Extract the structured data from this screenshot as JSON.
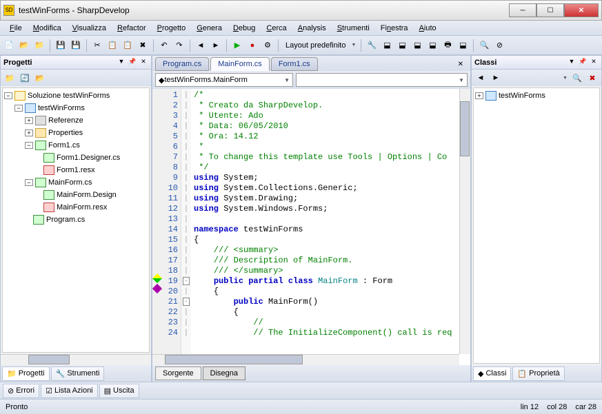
{
  "title": "testWinForms - SharpDevelop",
  "menu": [
    "File",
    "Modifica",
    "Visualizza",
    "Refactor",
    "Progetto",
    "Genera",
    "Debug",
    "Cerca",
    "Analysis",
    "Strumenti",
    "Finestra",
    "Aiuto"
  ],
  "toolbar_layout": "Layout predefinito",
  "panels": {
    "left": {
      "title": "Progetti"
    },
    "right": {
      "title": "Classi"
    }
  },
  "project_tree": {
    "solution": "Soluzione testWinForms",
    "project": "testWinForms",
    "referenze": "Referenze",
    "properties": "Properties",
    "form1": "Form1.cs",
    "form1_designer": "Form1.Designer.cs",
    "form1_resx": "Form1.resx",
    "mainform": "MainForm.cs",
    "mainform_designer": "MainForm.Design",
    "mainform_resx": "MainForm.resx",
    "program": "Program.cs"
  },
  "class_tree": {
    "root": "testWinForms"
  },
  "editor": {
    "tabs": [
      "Program.cs",
      "MainForm.cs",
      "Form1.cs"
    ],
    "active_tab": 1,
    "class_combo": "testWinForms.MainForm",
    "member_combo": "",
    "bottom_tabs": [
      "Sorgente",
      "Disegna"
    ]
  },
  "code": {
    "lines": [
      {
        "n": 1,
        "t": "/*",
        "cls": "c-comment"
      },
      {
        "n": 2,
        "t": " * Creato da SharpDevelop.",
        "cls": "c-comment"
      },
      {
        "n": 3,
        "t": " * Utente: Ado",
        "cls": "c-comment"
      },
      {
        "n": 4,
        "t": " * Data: 06/05/2010",
        "cls": "c-comment"
      },
      {
        "n": 5,
        "t": " * Ora: 14.12",
        "cls": "c-comment"
      },
      {
        "n": 6,
        "t": " * ",
        "cls": "c-comment"
      },
      {
        "n": 7,
        "t": " * To change this template use Tools | Options | Co",
        "cls": "c-comment"
      },
      {
        "n": 8,
        "t": " */",
        "cls": "c-comment"
      },
      {
        "n": 9,
        "html": "<span class='c-keyword'>using</span> System;"
      },
      {
        "n": 10,
        "html": "<span class='c-keyword'>using</span> System.Collections.Generic;"
      },
      {
        "n": 11,
        "html": "<span class='c-keyword'>using</span> System.Drawing;"
      },
      {
        "n": 12,
        "html": "<span class='c-keyword'>using</span> System.Windows.Forms;"
      },
      {
        "n": 13,
        "t": ""
      },
      {
        "n": 14,
        "html": "<span class='c-keyword'>namespace</span> testWinForms"
      },
      {
        "n": 15,
        "t": "{"
      },
      {
        "n": 16,
        "html": "    <span class='c-comment'>/// &lt;summary&gt;</span>"
      },
      {
        "n": 17,
        "html": "    <span class='c-comment'>/// Description of MainForm.</span>"
      },
      {
        "n": 18,
        "html": "    <span class='c-comment'>/// &lt;/summary&gt;</span>"
      },
      {
        "n": 19,
        "html": "    <span class='c-keyword'>public</span> <span class='c-keyword'>partial</span> <span class='c-keyword'>class</span> <span class='c-type'>MainForm</span> : Form",
        "fold": "-",
        "mark": "yg"
      },
      {
        "n": 20,
        "t": "    {",
        "mark": "pu"
      },
      {
        "n": 21,
        "html": "        <span class='c-keyword'>public</span> MainForm()",
        "fold": "-"
      },
      {
        "n": 22,
        "t": "        {"
      },
      {
        "n": 23,
        "html": "            <span class='c-comment'>//</span>"
      },
      {
        "n": 24,
        "html": "            <span class='c-comment'>// The InitializeComponent() call is req</span>"
      }
    ]
  },
  "left_bottom_tabs": [
    "Progetti",
    "Strumenti"
  ],
  "right_bottom_tabs": [
    "Classi",
    "Proprietà"
  ],
  "bottom_tabs": [
    "Errori",
    "Lista Azioni",
    "Uscita"
  ],
  "status": {
    "ready": "Pronto",
    "lin": "lin 12",
    "col": "col 28",
    "car": "car 28"
  }
}
